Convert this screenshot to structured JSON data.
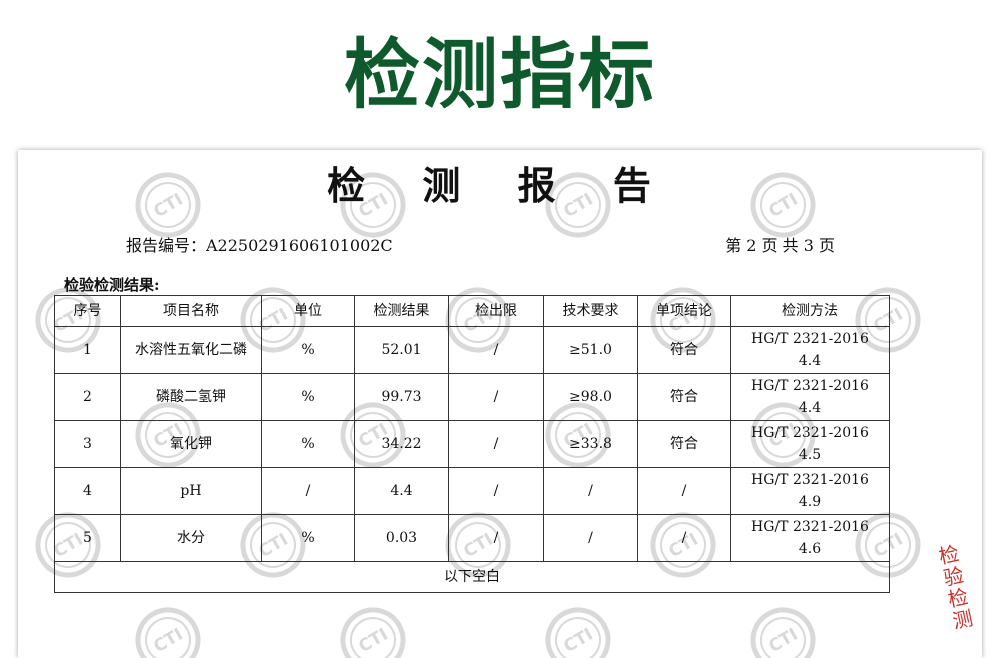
{
  "banner": {
    "title": "检测指标"
  },
  "report": {
    "title": "检 测 报 告",
    "number_text": "报告编号：A2250291606101002C",
    "page_text": "第 2 页  共 3 页",
    "section_label": "检验检测结果:",
    "watermark_text": "CTI",
    "columns": [
      "序号",
      "项目名称",
      "单位",
      "检测结果",
      "检出限",
      "技术要求",
      "单项结论",
      "检测方法"
    ],
    "rows": [
      {
        "no": "1",
        "item": "水溶性五氧化二磷",
        "unit": "%",
        "result": "52.01",
        "limit": "/",
        "requirement": "≥51.0",
        "conclusion": "符合",
        "method_line1": "HG/T 2321-2016",
        "method_line2": "4.4"
      },
      {
        "no": "2",
        "item": "磷酸二氢钾",
        "unit": "%",
        "result": "99.73",
        "limit": "/",
        "requirement": "≥98.0",
        "conclusion": "符合",
        "method_line1": "HG/T 2321-2016",
        "method_line2": "4.4"
      },
      {
        "no": "3",
        "item": "氧化钾",
        "unit": "%",
        "result": "34.22",
        "limit": "/",
        "requirement": "≥33.8",
        "conclusion": "符合",
        "method_line1": "HG/T 2321-2016",
        "method_line2": "4.5"
      },
      {
        "no": "4",
        "item": "pH",
        "unit": "/",
        "result": "4.4",
        "limit": "/",
        "requirement": "/",
        "conclusion": "/",
        "method_line1": "HG/T 2321-2016",
        "method_line2": "4.9"
      },
      {
        "no": "5",
        "item": "水分",
        "unit": "%",
        "result": "0.03",
        "limit": "/",
        "requirement": "/",
        "conclusion": "/",
        "method_line1": "HG/T 2321-2016",
        "method_line2": "4.6"
      }
    ],
    "footer_text": "以下空白",
    "stamp_text": "检验检测"
  },
  "colors": {
    "banner_green": "#0f5a2c",
    "stamp_red": "#c8322b",
    "watermark_gray": "#d9d9d9"
  }
}
